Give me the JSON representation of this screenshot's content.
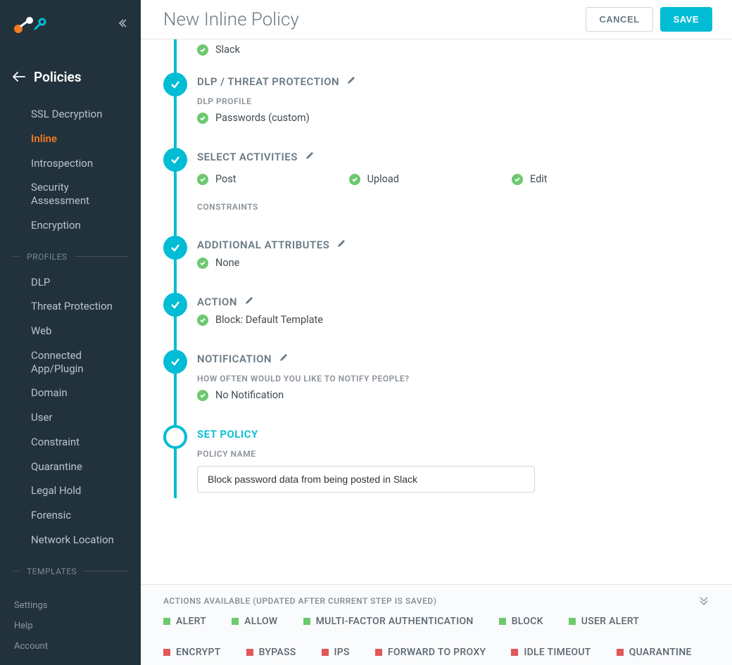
{
  "header": {
    "title": "New Inline Policy",
    "cancel": "CANCEL",
    "save": "SAVE"
  },
  "sidebar": {
    "title": "Policies",
    "nav": [
      {
        "label": "SSL Decryption",
        "active": false
      },
      {
        "label": "Inline",
        "active": true
      },
      {
        "label": "Introspection",
        "active": false
      },
      {
        "label": "Security Assessment",
        "active": false
      },
      {
        "label": "Encryption",
        "active": false
      }
    ],
    "section_profiles": "PROFILES",
    "profiles": [
      {
        "label": "DLP"
      },
      {
        "label": "Threat Protection"
      },
      {
        "label": "Web"
      },
      {
        "label": "Connected App/Plugin"
      },
      {
        "label": "Domain"
      },
      {
        "label": "User"
      },
      {
        "label": "Constraint"
      },
      {
        "label": "Quarantine"
      },
      {
        "label": "Legal Hold"
      },
      {
        "label": "Forensic"
      },
      {
        "label": "Network Location"
      }
    ],
    "section_templates": "TEMPLATES",
    "footer": [
      {
        "label": "Settings"
      },
      {
        "label": "Help"
      },
      {
        "label": "Account"
      }
    ]
  },
  "steps": {
    "first_item_value": "Slack",
    "dlp": {
      "title": "DLP / THREAT PROTECTION",
      "sublabel": "DLP PROFILE",
      "value": "Passwords (custom)"
    },
    "activities": {
      "title": "SELECT ACTIVITIES",
      "items": [
        "Post",
        "Upload",
        "Edit"
      ],
      "constraints_label": "CONSTRAINTS"
    },
    "attributes": {
      "title": "ADDITIONAL ATTRIBUTES",
      "value": "None"
    },
    "action": {
      "title": "ACTION",
      "value": "Block: Default Template"
    },
    "notification": {
      "title": "NOTIFICATION",
      "sublabel": "HOW OFTEN WOULD YOU LIKE TO NOTIFY PEOPLE?",
      "value": "No Notification"
    },
    "set_policy": {
      "title": "SET POLICY",
      "sublabel": "POLICY NAME",
      "input_value": "Block password data from being posted in Slack"
    }
  },
  "bottom": {
    "header": "ACTIONS AVAILABLE (UPDATED AFTER CURRENT STEP IS SAVED)",
    "available_color": "#6dc96f",
    "unavailable_color": "#e15858",
    "actions": [
      {
        "label": "ALERT",
        "available": true
      },
      {
        "label": "ALLOW",
        "available": true
      },
      {
        "label": "MULTI-FACTOR AUTHENTICATION",
        "available": true
      },
      {
        "label": "BLOCK",
        "available": true
      },
      {
        "label": "USER ALERT",
        "available": true
      },
      {
        "label": "ENCRYPT",
        "available": false
      },
      {
        "label": "BYPASS",
        "available": false
      },
      {
        "label": "IPS",
        "available": false
      },
      {
        "label": "FORWARD TO PROXY",
        "available": false
      },
      {
        "label": "IDLE TIMEOUT",
        "available": false
      },
      {
        "label": "QUARANTINE",
        "available": false
      }
    ]
  }
}
